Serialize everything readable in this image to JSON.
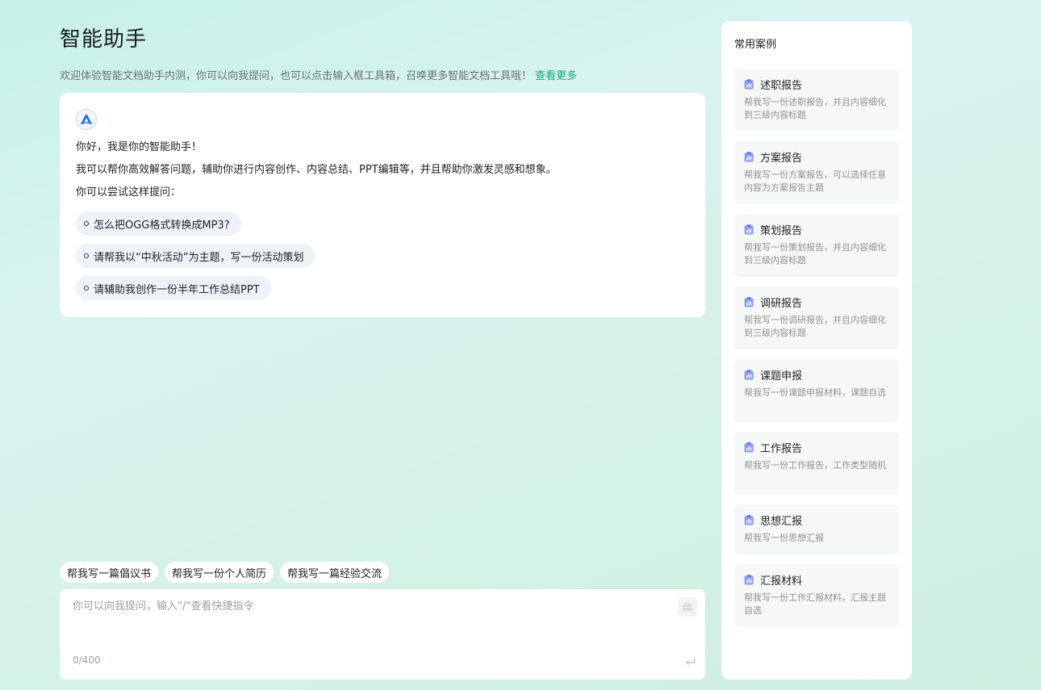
{
  "header": {
    "title": "智能助手",
    "intro": "欢迎体验智能文档助手内测，你可以向我提问，也可以点击输入框工具箱，召唤更多智能文档工具哦！",
    "more_link": "查看更多"
  },
  "welcome": {
    "greeting": "你好，我是你的智能助手！",
    "capabilities": "我可以帮你高效解答问题，辅助你进行内容创作、内容总结、PPT编辑等，并且帮助你激发灵感和想象。",
    "try_prompt": "你可以尝试这样提问：",
    "suggestions": [
      "怎么把OGG格式转换成MP3?",
      "请帮我以“中秋活动”为主题，写一份活动策划",
      "请辅助我创作一份半年工作总结PPT"
    ]
  },
  "quick_chips": [
    "帮我写一篇倡议书",
    "帮我写一份个人简历",
    "帮我写一篇经验交流"
  ],
  "input": {
    "placeholder": "你可以向我提问，输入\"/\"查看快捷指令",
    "counter": "0/400"
  },
  "sidebar": {
    "title": "常用案例",
    "cases": [
      {
        "title": "述职报告",
        "desc": "帮我写一份述职报告，并且内容细化到三级内容标题"
      },
      {
        "title": "方案报告",
        "desc": "帮我写一份方案报告，可以选择任意内容为方案报告主题"
      },
      {
        "title": "策划报告",
        "desc": "帮我写一份策划报告，并且内容细化到三级内容标题"
      },
      {
        "title": "调研报告",
        "desc": "帮我写一份调研报告，并且内容细化到三级内容标题"
      },
      {
        "title": "课题申报",
        "desc": "帮我写一份课题申报材料，课题自选"
      },
      {
        "title": "工作报告",
        "desc": "帮我写一份工作报告，工作类型随机"
      },
      {
        "title": "思想汇报",
        "desc": "帮我写一份思想汇报"
      },
      {
        "title": "汇报材料",
        "desc": "帮我写一份工作汇报材料，汇报主题自选"
      }
    ]
  },
  "colors": {
    "accent": "#17a673",
    "icon": "#7b8cf0",
    "card": "#ffffff"
  }
}
